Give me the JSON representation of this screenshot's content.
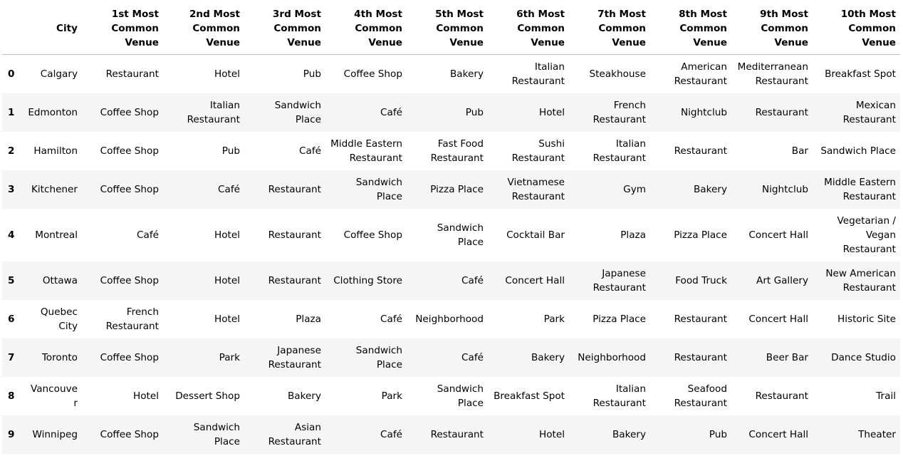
{
  "table": {
    "index_header": "",
    "columns": [
      "City",
      "1st Most Common Venue",
      "2nd Most Common Venue",
      "3rd Most Common Venue",
      "4th Most Common Venue",
      "5th Most Common Venue",
      "6th Most Common Venue",
      "7th Most Common Venue",
      "8th Most Common Venue",
      "9th Most Common Venue",
      "10th Most Common Venue"
    ],
    "rows": [
      {
        "index": "0",
        "cells": [
          "Calgary",
          "Restaurant",
          "Hotel",
          "Pub",
          "Coffee Shop",
          "Bakery",
          "Italian Restaurant",
          "Steakhouse",
          "American Restaurant",
          "Mediterranean Restaurant",
          "Breakfast Spot"
        ]
      },
      {
        "index": "1",
        "cells": [
          "Edmonton",
          "Coffee Shop",
          "Italian Restaurant",
          "Sandwich Place",
          "Café",
          "Pub",
          "Hotel",
          "French Restaurant",
          "Nightclub",
          "Restaurant",
          "Mexican Restaurant"
        ]
      },
      {
        "index": "2",
        "cells": [
          "Hamilton",
          "Coffee Shop",
          "Pub",
          "Café",
          "Middle Eastern Restaurant",
          "Fast Food Restaurant",
          "Sushi Restaurant",
          "Italian Restaurant",
          "Restaurant",
          "Bar",
          "Sandwich Place"
        ]
      },
      {
        "index": "3",
        "cells": [
          "Kitchener",
          "Coffee Shop",
          "Café",
          "Restaurant",
          "Sandwich Place",
          "Pizza Place",
          "Vietnamese Restaurant",
          "Gym",
          "Bakery",
          "Nightclub",
          "Middle Eastern Restaurant"
        ]
      },
      {
        "index": "4",
        "cells": [
          "Montreal",
          "Café",
          "Hotel",
          "Restaurant",
          "Coffee Shop",
          "Sandwich Place",
          "Cocktail Bar",
          "Plaza",
          "Pizza Place",
          "Concert Hall",
          "Vegetarian / Vegan Restaurant"
        ]
      },
      {
        "index": "5",
        "cells": [
          "Ottawa",
          "Coffee Shop",
          "Hotel",
          "Restaurant",
          "Clothing Store",
          "Café",
          "Concert Hall",
          "Japanese Restaurant",
          "Food Truck",
          "Art Gallery",
          "New American Restaurant"
        ]
      },
      {
        "index": "6",
        "cells": [
          "Quebec City",
          "French Restaurant",
          "Hotel",
          "Plaza",
          "Café",
          "Neighborhood",
          "Park",
          "Pizza Place",
          "Restaurant",
          "Concert Hall",
          "Historic Site"
        ]
      },
      {
        "index": "7",
        "cells": [
          "Toronto",
          "Coffee Shop",
          "Park",
          "Japanese Restaurant",
          "Sandwich Place",
          "Café",
          "Bakery",
          "Neighborhood",
          "Restaurant",
          "Beer Bar",
          "Dance Studio"
        ]
      },
      {
        "index": "8",
        "cells": [
          "Vancouver",
          "Hotel",
          "Dessert Shop",
          "Bakery",
          "Park",
          "Sandwich Place",
          "Breakfast Spot",
          "Italian Restaurant",
          "Seafood Restaurant",
          "Restaurant",
          "Trail"
        ]
      },
      {
        "index": "9",
        "cells": [
          "Winnipeg",
          "Coffee Shop",
          "Sandwich Place",
          "Asian Restaurant",
          "Café",
          "Restaurant",
          "Hotel",
          "Bakery",
          "Pub",
          "Concert Hall",
          "Theater"
        ]
      }
    ]
  }
}
